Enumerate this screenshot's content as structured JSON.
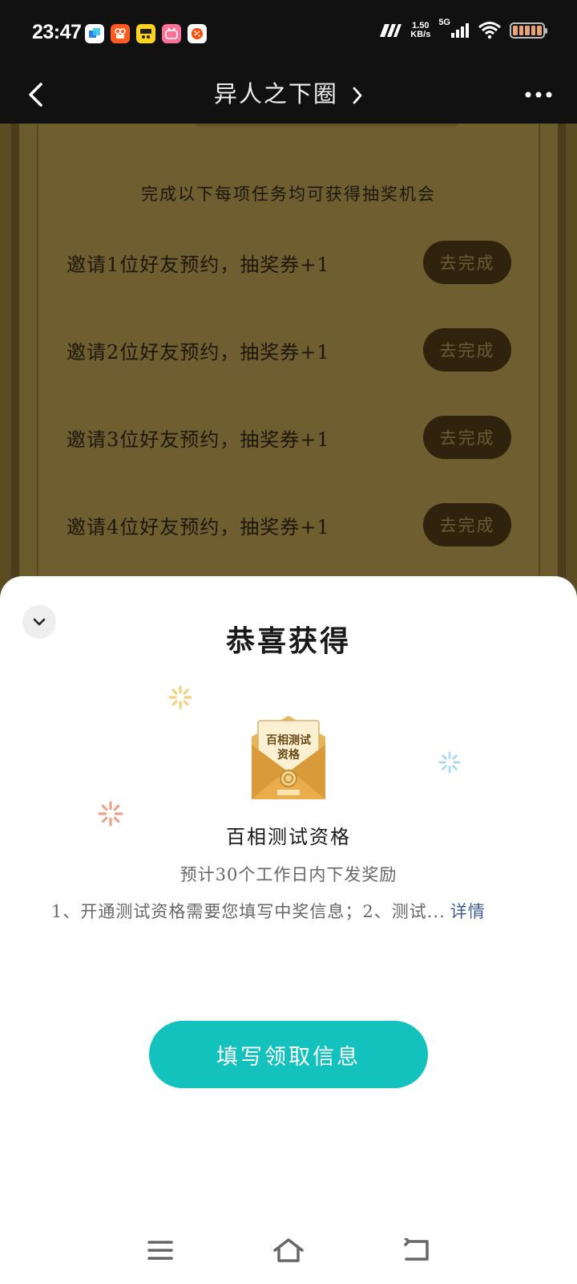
{
  "status_bar": {
    "time": "23:47",
    "net_speed_value": "1.50",
    "net_speed_unit": "KB/s",
    "network_type": "5G",
    "app_icons": [
      "feishu-icon",
      "kuaishou-icon",
      "kuwo-icon",
      "bilibili-icon",
      "taobao-icon"
    ]
  },
  "nav": {
    "title": "异人之下圈"
  },
  "tasks": {
    "intro": "完成以下每项任务均可获得抽奖机会",
    "items": [
      {
        "label": "邀请1位好友预约，抽奖券+1",
        "button": "去完成"
      },
      {
        "label": "邀请2位好友预约，抽奖券+1",
        "button": "去完成"
      },
      {
        "label": "邀请3位好友预约，抽奖券+1",
        "button": "去完成"
      },
      {
        "label": "邀请4位好友预约，抽奖券+1",
        "button": "去完成"
      }
    ]
  },
  "sheet": {
    "title": "恭喜获得",
    "prize_image_text": "百相测试资格",
    "prize_name": "百相测试资格",
    "eta": "预计30个工作日内下发奖励",
    "description": "1、开通测试资格需要您填写中奖信息；2、测试...",
    "detail_link": "详情",
    "claim_button": "填写领取信息"
  },
  "colors": {
    "accent": "#13c1bd",
    "link": "#3f5f95",
    "task_button_bg": "#2f230d"
  }
}
